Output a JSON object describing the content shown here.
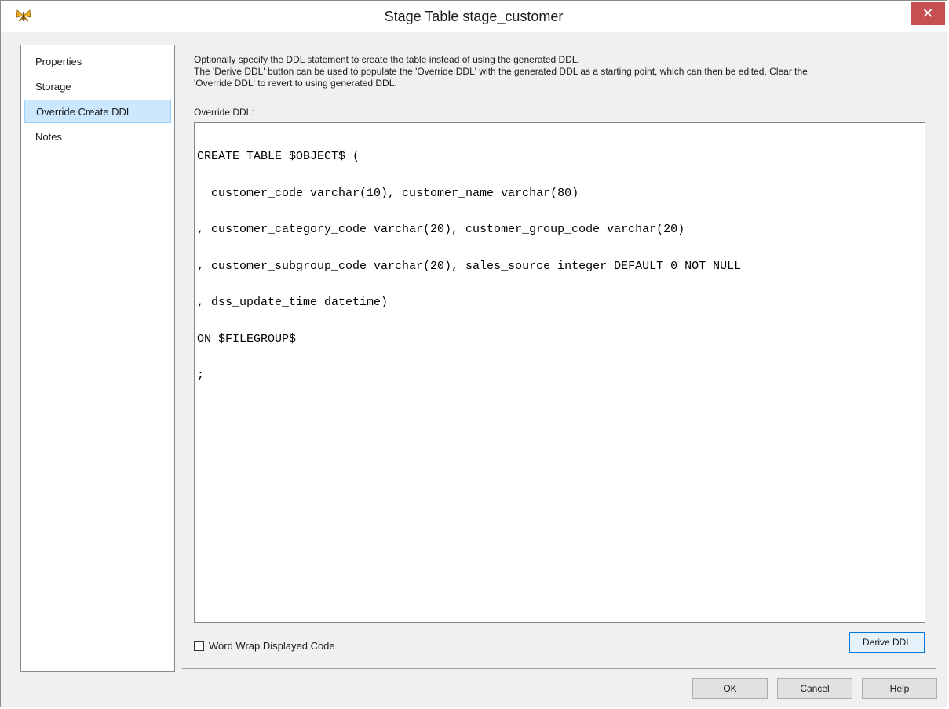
{
  "window": {
    "title": "Stage Table stage_customer",
    "close_glyph": "✕"
  },
  "sidebar": {
    "items": [
      {
        "label": "Properties",
        "selected": false
      },
      {
        "label": "Storage",
        "selected": false
      },
      {
        "label": "Override Create DDL",
        "selected": true
      },
      {
        "label": "Notes",
        "selected": false
      }
    ]
  },
  "main": {
    "description_lines": [
      "Optionally specify the DDL statement to create the table instead of using the generated DDL.",
      "The 'Derive DDL' button can be used to populate the 'Override DDL' with the generated DDL as a starting point, which can then be edited. Clear the",
      "'Override DDL' to revert to using generated DDL."
    ],
    "override_label": "Override DDL:",
    "code_lines": [
      "CREATE TABLE $OBJECT$ (",
      "  customer_code varchar(10), customer_name varchar(80)",
      ", customer_category_code varchar(20), customer_group_code varchar(20)",
      ", customer_subgroup_code varchar(20), sales_source integer DEFAULT 0 NOT NULL",
      ", dss_update_time datetime)",
      "ON $FILEGROUP$",
      ";"
    ],
    "word_wrap_label": "Word Wrap Displayed Code",
    "word_wrap_checked": false,
    "derive_button": "Derive DDL"
  },
  "footer": {
    "ok": "OK",
    "cancel": "Cancel",
    "help": "Help"
  },
  "colors": {
    "close_button": "#c75050",
    "selection": "#cce8ff",
    "focus_border": "#0078d7"
  }
}
